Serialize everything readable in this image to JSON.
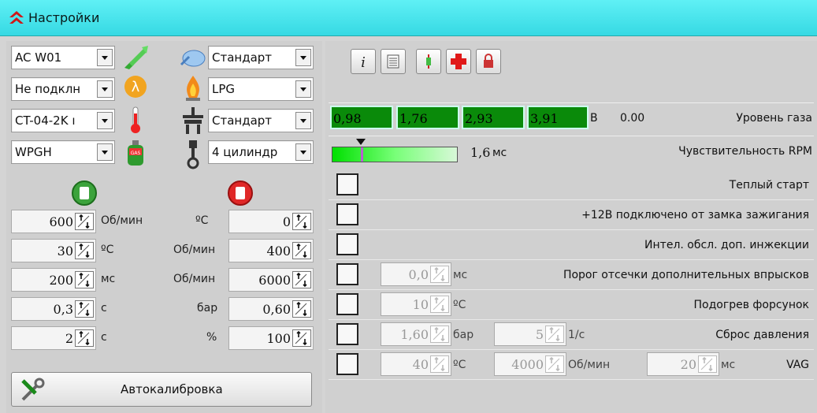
{
  "window": {
    "title": "Настройки"
  },
  "left": {
    "combos": [
      {
        "value": "AC W01"
      },
      {
        "value": "Не подклн"
      },
      {
        "value": "CT-04-2K ı"
      },
      {
        "value": "WPGH"
      },
      {
        "value": "Стандарт"
      },
      {
        "value": "LPG"
      },
      {
        "value": "Стандарт"
      },
      {
        "value": "4 цилиндр"
      }
    ],
    "gas_icon_text": "GAS",
    "left_params": [
      {
        "value": "600",
        "unit": "Об/мин"
      },
      {
        "value": "30",
        "unit": "ºC"
      },
      {
        "value": "200",
        "unit": "мс"
      },
      {
        "value": "0,3",
        "unit": "с"
      },
      {
        "value": "2",
        "unit": "с"
      }
    ],
    "right_params": [
      {
        "value": "0",
        "unit": "ºC"
      },
      {
        "value": "400",
        "unit": "Об/мин"
      },
      {
        "value": "6000",
        "unit": "Об/мин"
      },
      {
        "value": "0,60",
        "unit": "бар"
      },
      {
        "value": "100",
        "unit": "%"
      }
    ],
    "autocal_label": "Автокалибровка"
  },
  "right": {
    "toolbar": [
      "info-icon",
      "list-icon",
      "connector-icon",
      "plus-icon",
      "lock-icon"
    ],
    "gas_level": {
      "values": [
        "0,98",
        "1,76",
        "2,93",
        "3,91"
      ],
      "unit": "В",
      "reading": "0.00",
      "label": "Уровень газа"
    },
    "rpm": {
      "value": "1,6",
      "unit": "мс",
      "label": "Чувствительность RPM",
      "level": 0.23
    },
    "rows": [
      {
        "label": "Теплый старт"
      },
      {
        "label": "+12В подключено от замка зажигания"
      },
      {
        "label": "Интел. обсл. доп. инжекции"
      },
      {
        "label": "Порог отсечки дополнительных впрысков",
        "v1": "0,0",
        "u1": "мс"
      },
      {
        "label": "Подогрев форсунок",
        "v1": "10",
        "u1": "ºC"
      },
      {
        "label": "Сброс давления",
        "v1": "1,60",
        "u1": "бар",
        "v2": "5",
        "u2": "1/с"
      },
      {
        "label": "VAG",
        "v1": "40",
        "u1": "ºC",
        "v2": "4000",
        "u2": "Об/мин",
        "v3": "20",
        "u3": "мс"
      }
    ]
  }
}
